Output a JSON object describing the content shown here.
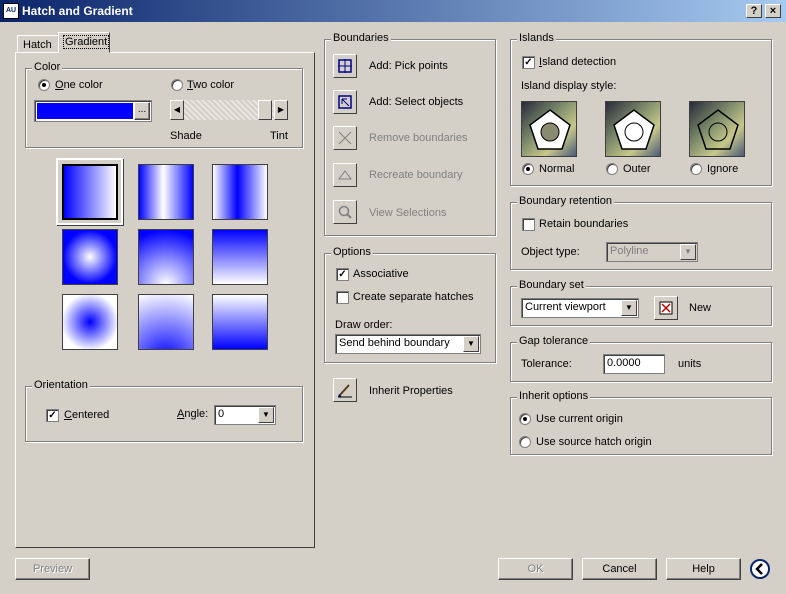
{
  "window": {
    "title": "Hatch and Gradient",
    "help_label": "?",
    "close_label": "×"
  },
  "tabs": [
    {
      "label": "Hatch"
    },
    {
      "label": "Gradient"
    }
  ],
  "color": {
    "legend": "Color",
    "one_color_label": "One color",
    "two_color_label": "Two color",
    "selected": "one",
    "swatch_color": "#0000ff",
    "browse_label": "...",
    "shade_label": "Shade",
    "tint_label": "Tint"
  },
  "gradient_patterns": [
    "linear-lr",
    "cylinder-v",
    "inv-cylinder-v",
    "spherical",
    "hemispherical",
    "curved",
    "inv-spherical",
    "inv-hemispherical",
    "inv-curved"
  ],
  "orientation": {
    "legend": "Orientation",
    "centered_label": "Centered",
    "centered_checked": true,
    "angle_label": "Angle:",
    "angle_value": "0"
  },
  "boundaries": {
    "legend": "Boundaries",
    "items": [
      {
        "label": "Add: Pick points",
        "enabled": true,
        "icon": "pick-points-icon"
      },
      {
        "label": "Add: Select objects",
        "enabled": true,
        "icon": "select-objects-icon"
      },
      {
        "label": "Remove boundaries",
        "enabled": false,
        "icon": "remove-boundaries-icon"
      },
      {
        "label": "Recreate boundary",
        "enabled": false,
        "icon": "recreate-boundary-icon"
      },
      {
        "label": "View Selections",
        "enabled": false,
        "icon": "magnifier-icon"
      }
    ]
  },
  "options": {
    "legend": "Options",
    "associative_label": "Associative",
    "associative_checked": true,
    "separate_label": "Create separate hatches",
    "separate_checked": false,
    "draw_order_label": "Draw order:",
    "draw_order_value": "Send behind boundary"
  },
  "inherit": {
    "label": "Inherit Properties"
  },
  "islands": {
    "legend": "Islands",
    "detection_label": "Island detection",
    "detection_checked": true,
    "style_label": "Island display style:",
    "styles": [
      {
        "label": "Normal"
      },
      {
        "label": "Outer"
      },
      {
        "label": "Ignore"
      }
    ],
    "selected": "Normal"
  },
  "retention": {
    "legend": "Boundary retention",
    "retain_label": "Retain boundaries",
    "retain_checked": false,
    "object_type_label": "Object type:",
    "object_type_value": "Polyline"
  },
  "boundary_set": {
    "legend": "Boundary set",
    "value": "Current viewport",
    "new_label": "New"
  },
  "gap": {
    "legend": "Gap tolerance",
    "tolerance_label": "Tolerance:",
    "tolerance_value": "0.0000",
    "units_label": "units"
  },
  "inherit_options": {
    "legend": "Inherit options",
    "current_label": "Use current origin",
    "source_label": "Use source hatch origin",
    "selected": "current"
  },
  "footer": {
    "preview_label": "Preview",
    "ok_label": "OK",
    "cancel_label": "Cancel",
    "help_label": "Help"
  }
}
